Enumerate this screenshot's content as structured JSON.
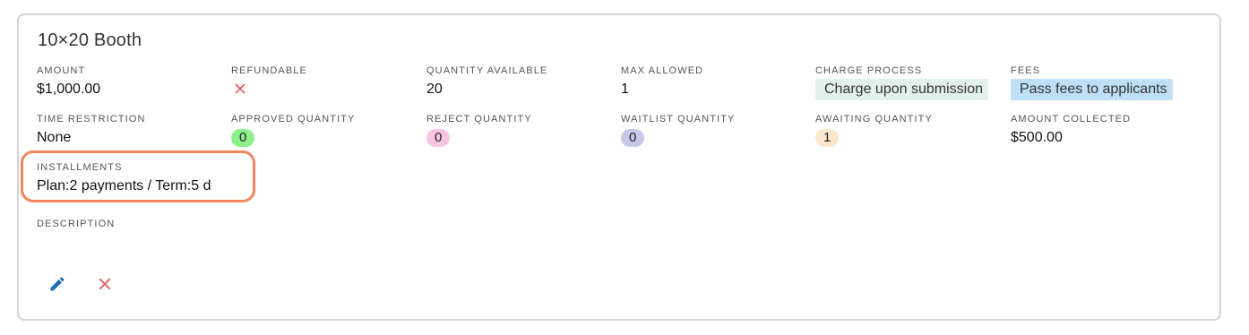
{
  "card": {
    "title": "10×20 Booth",
    "row1": [
      {
        "label": "AMOUNT",
        "value": "$1,000.00"
      },
      {
        "label": "REFUNDABLE",
        "icon": "x-icon"
      },
      {
        "label": "QUANTITY AVAILABLE",
        "value": "20"
      },
      {
        "label": "MAX ALLOWED",
        "value": "1"
      },
      {
        "label": "CHARGE PROCESS",
        "value": "Charge upon submission",
        "color": "#e3f1ec"
      },
      {
        "label": "FEES",
        "value": "Pass fees to applicants",
        "color": "#bfe0f8"
      }
    ],
    "row2": [
      {
        "label": "TIME RESTRICTION",
        "value": "None"
      },
      {
        "label": "APPROVED QUANTITY",
        "value": "0",
        "color": "#8ef08a"
      },
      {
        "label": "REJECT QUANTITY",
        "value": "0",
        "color": "#f9c6e2"
      },
      {
        "label": "WAITLIST QUANTITY",
        "value": "0",
        "color": "#c6c9e6"
      },
      {
        "label": "AWAITING QUANTITY",
        "value": "1",
        "color": "#fbe7cc"
      },
      {
        "label": "AMOUNT COLLECTED",
        "value": "$500.00"
      }
    ],
    "installments": {
      "label": "INSTALLMENTS",
      "value": "Plan:2 payments / Term:5 d"
    },
    "description": {
      "label": "DESCRIPTION",
      "value": ""
    },
    "actions": {
      "edit_icon": "pencil-icon",
      "delete_icon": "x-icon",
      "edit_color": "#1a6fb5",
      "delete_color": "#e35a5a"
    },
    "highlight_color": "#f0875d"
  }
}
